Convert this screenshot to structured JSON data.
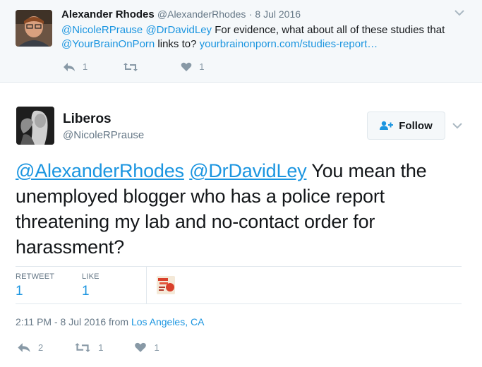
{
  "parent_tweet": {
    "author_name": "Alexander Rhodes",
    "author_handle": "@AlexanderRhodes",
    "separator": "·",
    "date": "8 Jul 2016",
    "mention_1": "@NicoleRPrause",
    "mention_2": "@DrDavidLey",
    "text_1": " For evidence, what about all of these studies that",
    "mention_3": "@YourBrainOnPorn",
    "text_2": " links to? ",
    "link": "yourbrainonporn.com/studies-report…",
    "reply_count": "1",
    "retweet_count": "",
    "like_count": "1"
  },
  "main_tweet": {
    "author_name": "Liberos",
    "author_handle": "@NicoleRPrause",
    "follow_label": "Follow",
    "mention_1": "@AlexanderRhodes",
    "mention_2": "@DrDavidLey",
    "text": " You mean the unemployed blogger who has a police report threatening my lab and no-contact order for harassment?",
    "stats": {
      "retweet_label": "RETWEET",
      "retweet_value": "1",
      "like_label": "LIKE",
      "like_value": "1"
    },
    "timestamp": "2:11 PM - 8 Jul 2016 from ",
    "location": "Los Angeles, CA",
    "reply_count": "2",
    "retweet_count": "1",
    "like_count": "1"
  },
  "colors": {
    "link": "#1b95e0",
    "muted": "#657786",
    "icon": "#8899a6"
  }
}
